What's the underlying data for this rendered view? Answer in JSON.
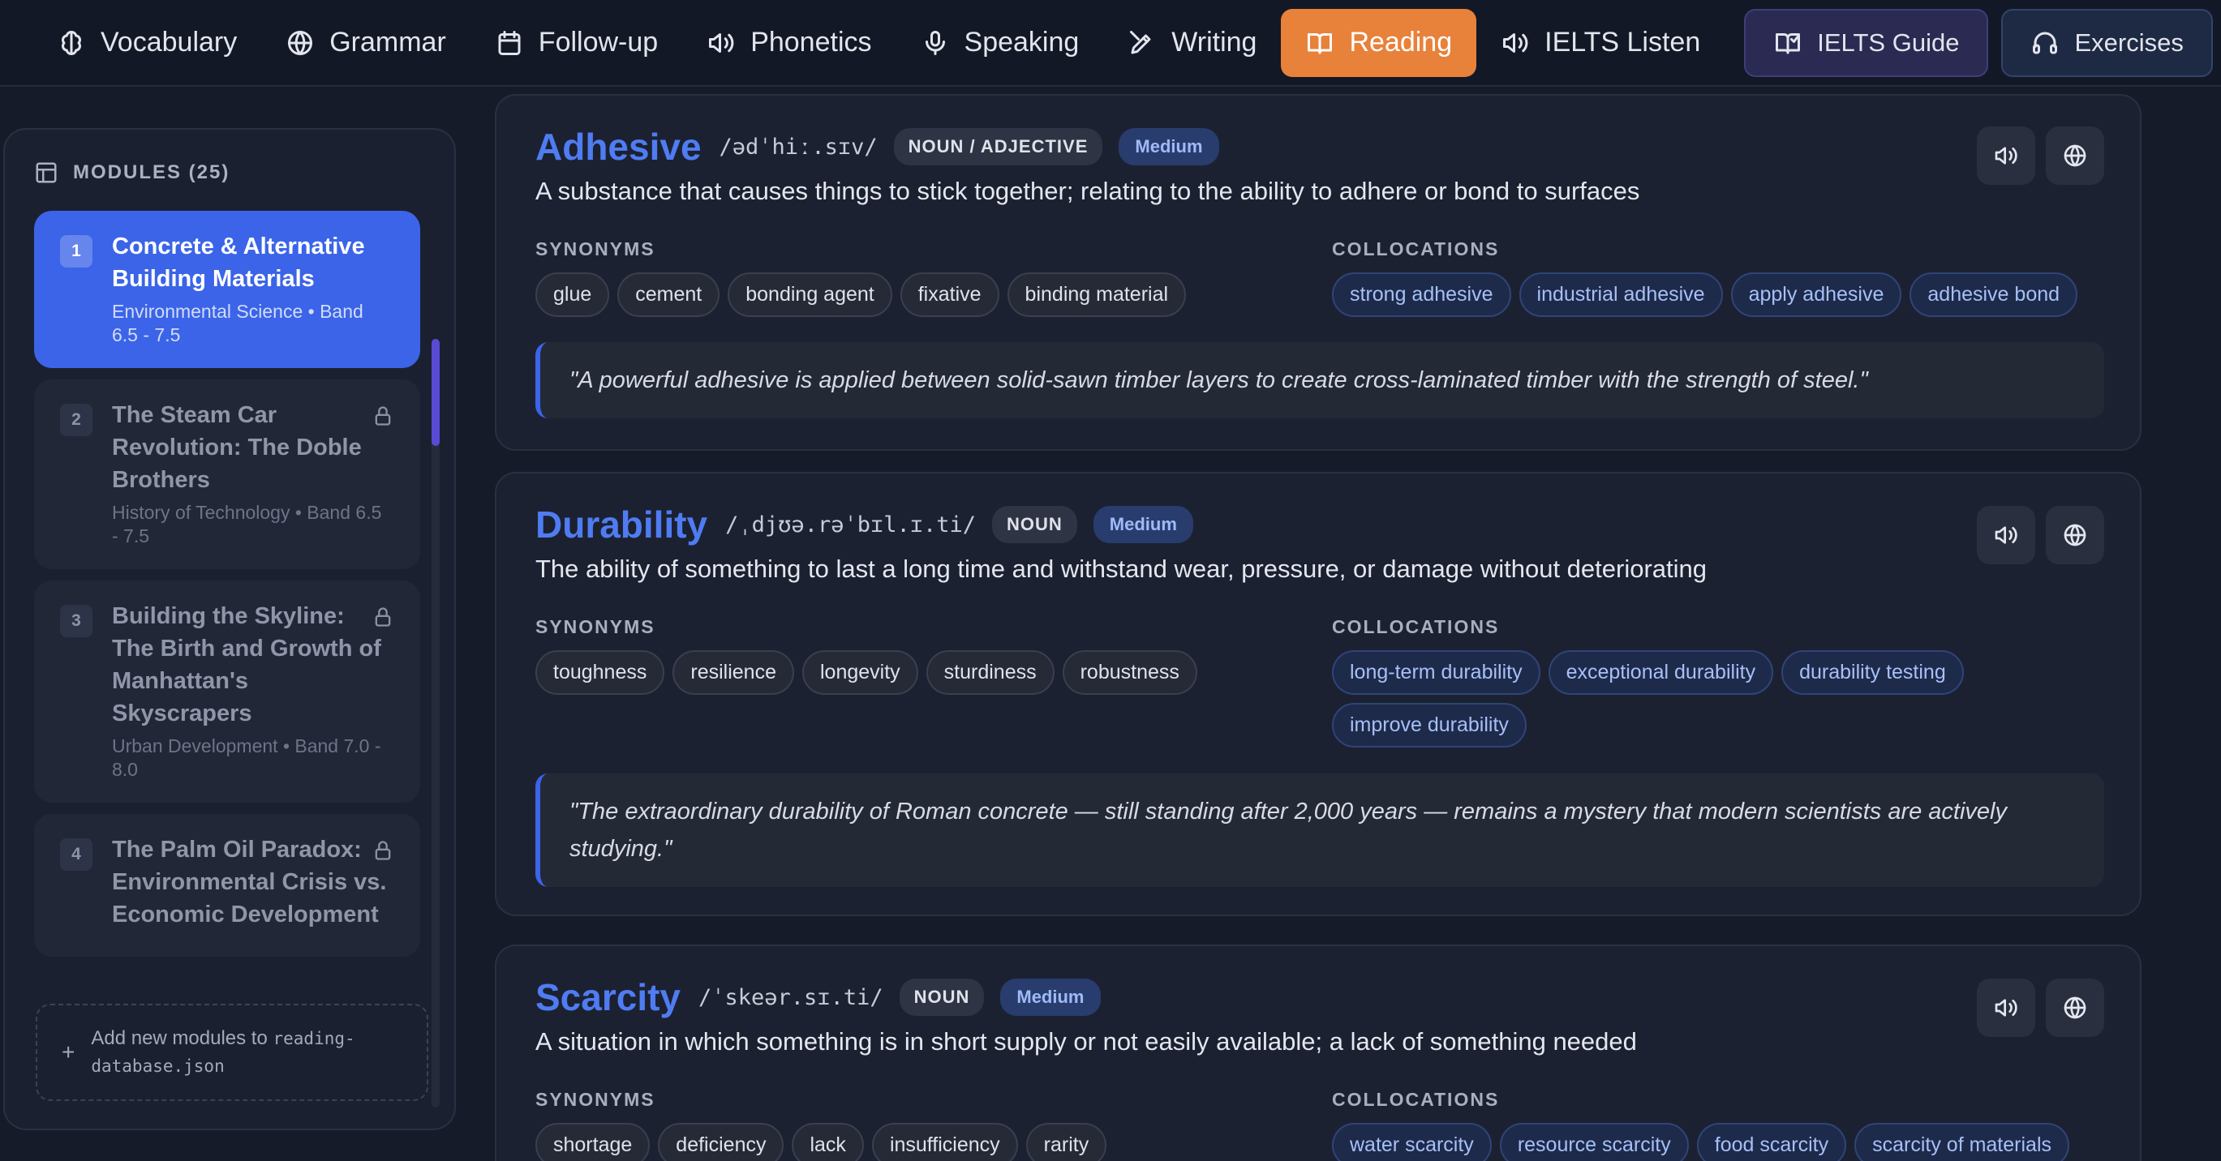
{
  "nav": {
    "items": [
      {
        "label": "Vocabulary",
        "icon": "brain-icon"
      },
      {
        "label": "Grammar",
        "icon": "globe-icon"
      },
      {
        "label": "Follow-up",
        "icon": "calendar-icon"
      },
      {
        "label": "Phonetics",
        "icon": "speaker-icon"
      },
      {
        "label": "Speaking",
        "icon": "microphone-icon"
      },
      {
        "label": "Writing",
        "icon": "pen-icon"
      },
      {
        "label": "Reading",
        "icon": "book-icon",
        "active": true
      },
      {
        "label": "IELTS Listen",
        "icon": "speaker-icon"
      }
    ],
    "guide_label": "IELTS Guide",
    "exercises_label": "Exercises"
  },
  "sidebar": {
    "heading": "MODULES (25)",
    "modules": [
      {
        "num": "1",
        "title": "Concrete & Alternative Building Materials",
        "subtitle": "Environmental Science • Band 6.5 - 7.5",
        "active": true,
        "locked": false
      },
      {
        "num": "2",
        "title": "The Steam Car Revolution: The Doble Brothers",
        "subtitle": "History of Technology • Band 6.5 - 7.5",
        "active": false,
        "locked": true
      },
      {
        "num": "3",
        "title": "Building the Skyline: The Birth and Growth of Manhattan's Skyscrapers",
        "subtitle": "Urban Development • Band 7.0 - 8.0",
        "active": false,
        "locked": true
      },
      {
        "num": "4",
        "title": "The Palm Oil Paradox: Environmental Crisis vs. Economic Development",
        "subtitle": "",
        "active": false,
        "locked": true
      }
    ],
    "add_text": "Add new modules to",
    "add_code": "reading-database.json"
  },
  "section_labels": {
    "synonyms": "SYNONYMS",
    "collocations": "COLLOCATIONS"
  },
  "words": [
    {
      "word": "Adhesive",
      "ipa": "/ədˈhiː.sɪv/",
      "pos": "NOUN / ADJECTIVE",
      "level": "Medium",
      "definition": "A substance that causes things to stick together; relating to the ability to adhere or bond to surfaces",
      "synonyms": [
        "glue",
        "cement",
        "bonding agent",
        "fixative",
        "binding material"
      ],
      "collocations": [
        "strong adhesive",
        "industrial adhesive",
        "apply adhesive",
        "adhesive bond"
      ],
      "example": "\"A powerful adhesive is applied between solid-sawn timber layers to create cross-laminated timber with the strength of steel.\""
    },
    {
      "word": "Durability",
      "ipa": "/ˌdjʊə.rəˈbɪl.ɪ.ti/",
      "pos": "NOUN",
      "level": "Medium",
      "definition": "The ability of something to last a long time and withstand wear, pressure, or damage without deteriorating",
      "synonyms": [
        "toughness",
        "resilience",
        "longevity",
        "sturdiness",
        "robustness"
      ],
      "collocations": [
        "long-term durability",
        "exceptional durability",
        "durability testing",
        "improve durability"
      ],
      "example": "\"The extraordinary durability of Roman concrete — still standing after 2,000 years — remains a mystery that modern scientists are actively studying.\""
    },
    {
      "word": "Scarcity",
      "ipa": "/ˈskeər.sɪ.ti/",
      "pos": "NOUN",
      "level": "Medium",
      "definition": "A situation in which something is in short supply or not easily available; a lack of something needed",
      "synonyms": [
        "shortage",
        "deficiency",
        "lack",
        "insufficiency",
        "rarity"
      ],
      "collocations": [
        "water scarcity",
        "resource scarcity",
        "food scarcity",
        "scarcity of materials"
      ]
    }
  ]
}
